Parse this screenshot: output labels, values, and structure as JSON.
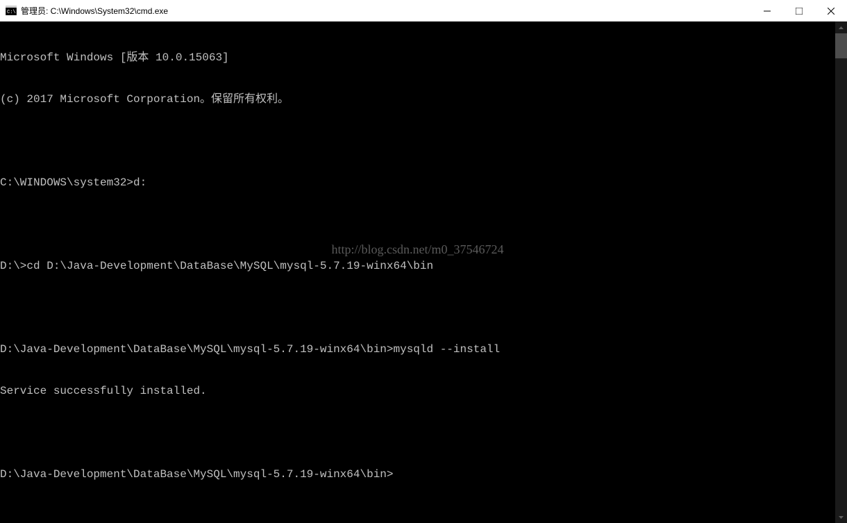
{
  "window": {
    "title": "管理员: C:\\Windows\\System32\\cmd.exe"
  },
  "terminal": {
    "lines": [
      "Microsoft Windows [版本 10.0.15063]",
      "(c) 2017 Microsoft Corporation。保留所有权利。",
      "",
      "C:\\WINDOWS\\system32>d:",
      "",
      "D:\\>cd D:\\Java-Development\\DataBase\\MySQL\\mysql-5.7.19-winx64\\bin",
      "",
      "D:\\Java-Development\\DataBase\\MySQL\\mysql-5.7.19-winx64\\bin>mysqld --install",
      "Service successfully installed.",
      "",
      "D:\\Java-Development\\DataBase\\MySQL\\mysql-5.7.19-winx64\\bin>"
    ]
  },
  "watermark": {
    "text": "http://blog.csdn.net/m0_37546724"
  }
}
